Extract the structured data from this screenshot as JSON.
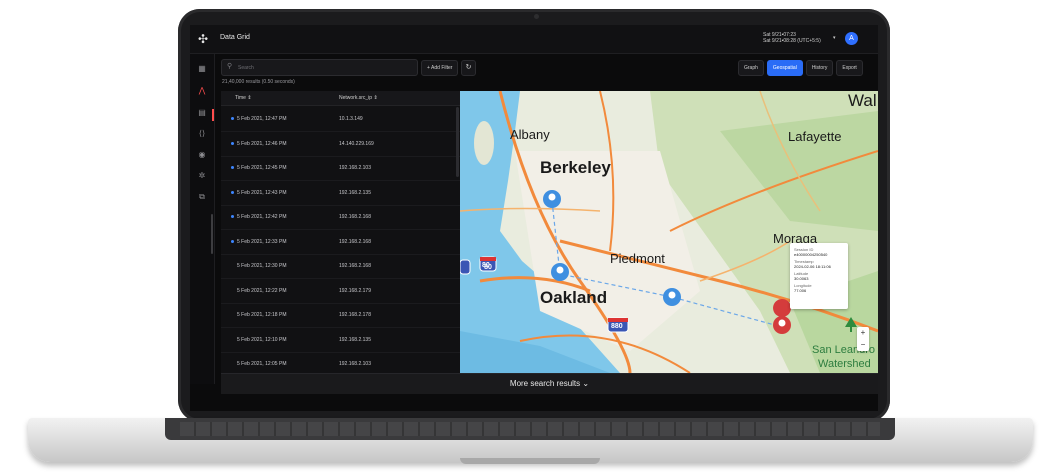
{
  "app": {
    "title": "Data Grid",
    "logo_icon": "app-logo-icon",
    "avatar_initial": "A",
    "accent": "#2a6cf6"
  },
  "time_range": {
    "line1": "Sat 9/21•07:23",
    "line2": "Sat 9/21•08:28 (UTC+5:5)"
  },
  "search": {
    "placeholder": "Search"
  },
  "toolbar": {
    "add_filter": "+ Add Filter",
    "refresh_icon": "refresh-icon"
  },
  "results_text": "21,40,000 results (0.50 seconds)",
  "views": [
    "Graph",
    "Geospatial",
    "History",
    "Export"
  ],
  "active_view": "Geospatial",
  "table": {
    "columns": [
      "Time ⇕",
      "Network.src_ip ⇕"
    ],
    "rows": [
      {
        "time": "5 Feb 2021, 12:47 PM",
        "ip": "10.1.3.149",
        "marked": true
      },
      {
        "time": "5 Feb 2021, 12:46 PM",
        "ip": "14.140.229.169",
        "marked": true
      },
      {
        "time": "5 Feb 2021, 12:45 PM",
        "ip": "192.168.2.103",
        "marked": true
      },
      {
        "time": "5 Feb 2021, 12:43 PM",
        "ip": "192.168.2.135",
        "marked": true
      },
      {
        "time": "5 Feb 2021, 12:42 PM",
        "ip": "192.168.2.168",
        "marked": true
      },
      {
        "time": "5 Feb 2021, 12:33 PM",
        "ip": "192.168.2.168",
        "marked": true
      },
      {
        "time": "5 Feb 2021, 12:30 PM",
        "ip": "192.168.2.168",
        "marked": false
      },
      {
        "time": "5 Feb 2021, 12:22 PM",
        "ip": "192.168.2.179",
        "marked": false
      },
      {
        "time": "5 Feb 2021, 12:18 PM",
        "ip": "192.168.2.178",
        "marked": false
      },
      {
        "time": "5 Feb 2021, 12:10 PM",
        "ip": "192.168.2.135",
        "marked": false
      },
      {
        "time": "5 Feb 2021, 12:05 PM",
        "ip": "192.168.2.103",
        "marked": false
      }
    ]
  },
  "map": {
    "labels": [
      "Albany",
      "Berkeley",
      "Lafayette",
      "Moraga",
      "Piedmont",
      "Oakland",
      "San Leandro",
      "Watershed",
      "Wal"
    ],
    "highway_shields": [
      "80",
      "80",
      "880"
    ],
    "tooltip": {
      "session_label": "Session ID",
      "session_value": "e40000004250540",
      "timestamp_label": "Timestamp",
      "timestamp_value": "2024-02-06 18:11:06",
      "latitude_label": "Latitude",
      "latitude_value": "30.0063",
      "longitude_label": "Longitude",
      "longitude_value": "77.006"
    },
    "zoom_in": "+",
    "zoom_out": "−"
  },
  "more_results": "More search results ⌄"
}
